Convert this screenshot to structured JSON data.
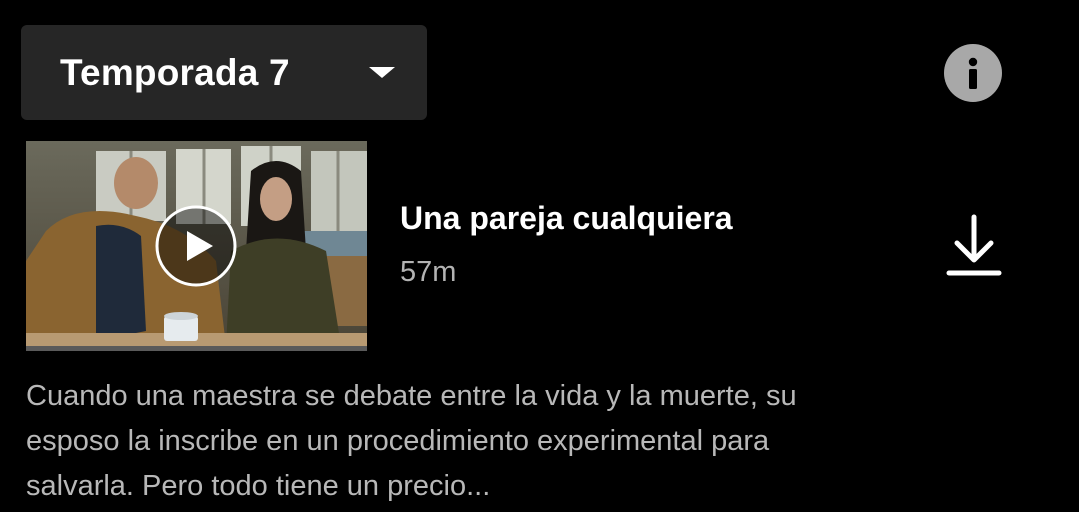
{
  "season_selector": {
    "label": "Temporada 7",
    "icon": "chevron-down-icon"
  },
  "info_button": {
    "icon": "info-icon"
  },
  "episode": {
    "title": "Una pareja cualquiera",
    "duration": "57m",
    "thumbnail_icon": "play-icon",
    "download_icon": "download-icon",
    "progress": 0,
    "synopsis": "Cuando una maestra se debate entre la vida y la muerte, su\nesposo la inscribe en un procedimiento experimental para\nsalvarla. Pero todo tiene un precio..."
  },
  "colors": {
    "background": "#000000",
    "selector_bg": "#262626",
    "info_circle": "#a8a8a8",
    "secondary_text": "#b3b3b3"
  }
}
